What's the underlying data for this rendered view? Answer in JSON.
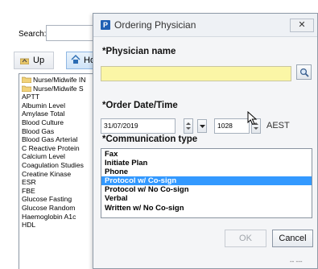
{
  "background": {
    "search_label": "Search:",
    "search_value": "",
    "up_label": "Up",
    "home_label": "Ho",
    "items": [
      {
        "label": "Nurse/Midwife IN",
        "icon": "folder-icon"
      },
      {
        "label": "Nurse/Midwife S",
        "icon": "folder-icon"
      },
      {
        "label": "APTT"
      },
      {
        "label": "Albumin Level"
      },
      {
        "label": "Amylase Total"
      },
      {
        "label": "Blood Culture"
      },
      {
        "label": "Blood Gas"
      },
      {
        "label": "Blood Gas Arterial"
      },
      {
        "label": "C Reactive Protein"
      },
      {
        "label": "Calcium Level"
      },
      {
        "label": "Coagulation Studies"
      },
      {
        "label": "Creatine Kinase"
      },
      {
        "label": "ESR"
      },
      {
        "label": "FBE"
      },
      {
        "label": "Glucose Fasting"
      },
      {
        "label": "Glucose Random"
      },
      {
        "label": "Haemoglobin A1c"
      },
      {
        "label": "HDL"
      }
    ]
  },
  "dialog": {
    "app_icon_letter": "P",
    "title": "Ordering Physician",
    "close_label": "✕",
    "physician_label": "*Physician name",
    "physician_value": "",
    "order_label": "*Order Date/Time",
    "date_value": "31/07/2019",
    "time_value": "1028",
    "timezone": "AEST",
    "comm_label": "*Communication type",
    "comm_options": [
      "Fax",
      "Initiate Plan",
      "Phone",
      "Protocol w/ Co-sign",
      "Protocol w/ No Co-sign",
      "Verbal",
      "Written w/ No Co-sign"
    ],
    "comm_selected": "Protocol w/ Co-sign",
    "ok_label": "OK",
    "cancel_label": "Cancel",
    "footer_text": "-- ---"
  },
  "colors": {
    "selection": "#3399ff",
    "required_field": "#fbf6a6",
    "app_icon": "#1f5fb4"
  }
}
